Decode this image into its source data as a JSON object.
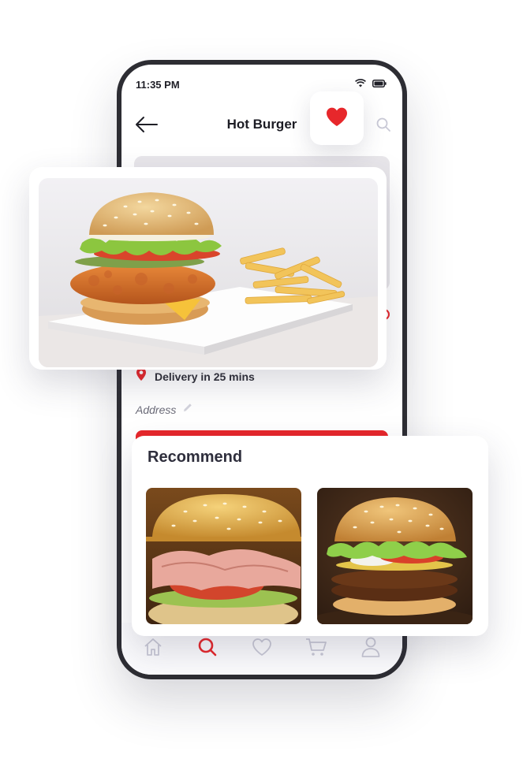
{
  "status_bar": {
    "time": "11:35 PM"
  },
  "header": {
    "title": "Hot Burger"
  },
  "delivery": {
    "text": "Delivery in 25 mins"
  },
  "address": {
    "placeholder": "Address"
  },
  "recommend": {
    "title": "Recommend"
  },
  "nav": {
    "items": [
      "home-icon",
      "search-icon",
      "heart-icon",
      "cart-icon",
      "profile-icon"
    ],
    "active": "search-icon"
  },
  "colors": {
    "accent": "#e7272b",
    "text": "#2e2e3c",
    "muted": "#6b6b78",
    "nav_inactive": "#c9c9d6"
  }
}
